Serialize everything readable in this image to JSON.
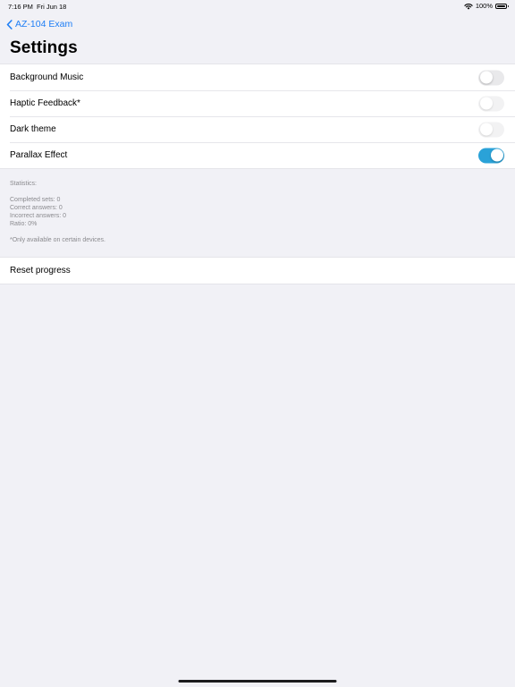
{
  "status_bar": {
    "time": "7:16 PM",
    "date": "Fri Jun 18",
    "battery_text": "100%"
  },
  "nav": {
    "back_label": "AZ-104 Exam"
  },
  "title": "Settings",
  "settings": [
    {
      "label": "Background Music",
      "on": false,
      "enabled": true
    },
    {
      "label": "Haptic Feedback*",
      "on": false,
      "enabled": false
    },
    {
      "label": "Dark theme",
      "on": false,
      "enabled": false
    },
    {
      "label": "Parallax Effect",
      "on": true,
      "enabled": true
    }
  ],
  "statistics": {
    "header": "Statistics:",
    "lines": [
      "Completed sets: 0",
      "Correct answers: 0",
      "Incorrect answers: 0",
      "Ratio: 0%"
    ],
    "note": "*Only available on certain devices."
  },
  "reset": {
    "label": "Reset progress"
  },
  "colors": {
    "accent": "#1e7ef5",
    "toggle_on": "#2aa2d8",
    "background": "#f1f1f6"
  }
}
